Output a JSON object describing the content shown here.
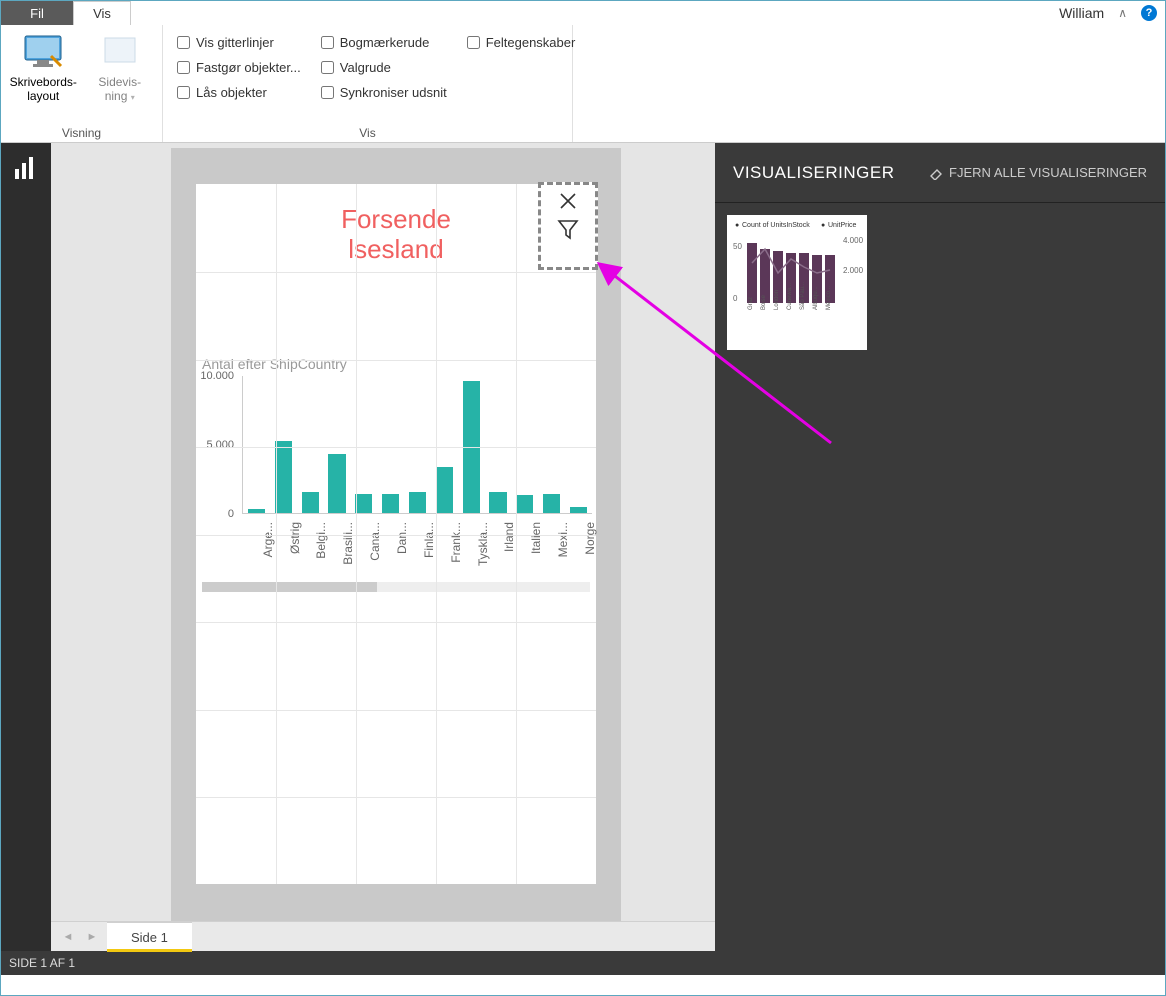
{
  "tabs": {
    "fil": "Fil",
    "vis": "Vis"
  },
  "user": "William",
  "ribbon": {
    "group_view": "Visning",
    "group_vis": "Vis",
    "btn_desktop_l1": "Skrivebords-",
    "btn_desktop_l2": "layout",
    "btn_pageview_l1": "Sidevis-",
    "btn_pageview_l2": "ning",
    "chk_grid": "Vis gitterlinjer",
    "chk_snap": "Fastgør objekter...",
    "chk_lock": "Lås objekter",
    "chk_bookmark": "Bogmærkerude",
    "chk_select": "Valgrude",
    "chk_sync": "Synkroniser udsnit",
    "chk_field": "Feltegenskaber"
  },
  "right": {
    "title": "VISUALISERINGER",
    "clear": "FJERN ALLE VISUALISERINGER",
    "thumb_legend1": "Count of UnitsInStock",
    "thumb_legend2": "UnitPrice"
  },
  "phone": {
    "header_title_l1": "Forsende",
    "header_title_l2": "lsesland"
  },
  "chart_data": {
    "type": "bar",
    "title": "Antal efter ShipCountry",
    "ylabel": "",
    "xlabel": "",
    "ylim": [
      0,
      10000
    ],
    "yticks": [
      0,
      5000,
      10000
    ],
    "ytick_labels": [
      "0",
      "5.000",
      "10.000"
    ],
    "categories": [
      "Arge...",
      "Østrig",
      "Belgi...",
      "Brasili...",
      "Cana...",
      "Dan...",
      "Finla...",
      "Frank...",
      "Tyskla...",
      "Irland",
      "Italien",
      "Mexi...",
      "Norge"
    ],
    "values": [
      300,
      5200,
      1500,
      4300,
      1400,
      1400,
      1500,
      3300,
      9600,
      1500,
      1300,
      1400,
      400
    ]
  },
  "thumb_chart": {
    "type": "bar",
    "categories": [
      "Graz",
      "Boise",
      "London",
      "Cunewa...",
      "São Pau...",
      "Albuqu...",
      "México..."
    ],
    "left_ticks": [
      0,
      50
    ],
    "right_ticks": [
      2000,
      4000
    ]
  },
  "pages": {
    "tab1": "Side 1"
  },
  "status": "SIDE 1 AF 1"
}
